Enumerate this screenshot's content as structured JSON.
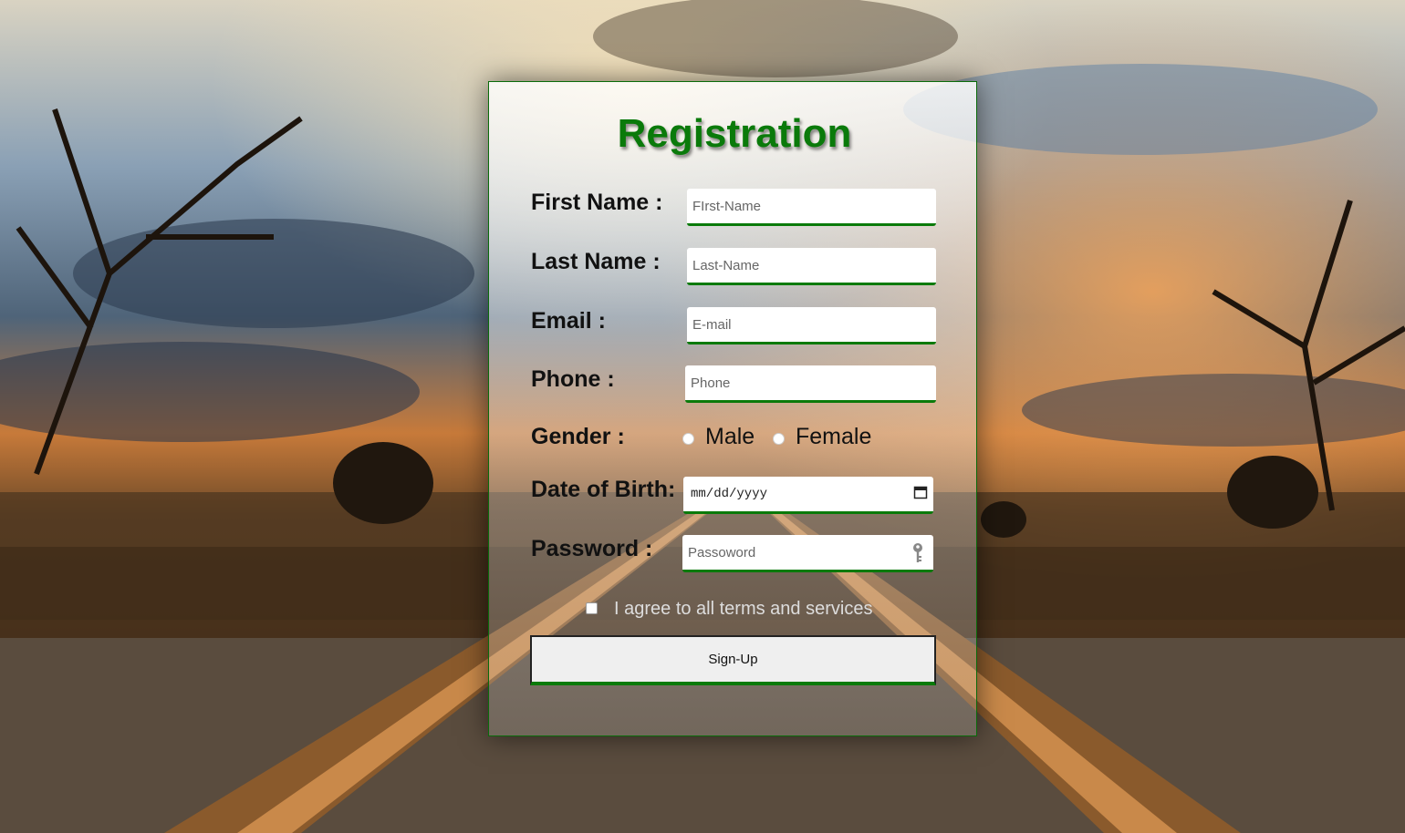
{
  "form": {
    "title": "Registration",
    "accent_color": "#0a7a0a",
    "first_name": {
      "label": "First Name :",
      "placeholder": "FIrst-Name"
    },
    "last_name": {
      "label": "Last Name :",
      "placeholder": "Last-Name"
    },
    "email": {
      "label": "Email :",
      "placeholder": "E-mail"
    },
    "phone": {
      "label": "Phone :",
      "placeholder": "Phone"
    },
    "gender": {
      "label": "Gender :",
      "options": [
        "Male",
        "Female"
      ]
    },
    "dob": {
      "label": "Date of Birth:",
      "placeholder": "mm/dd/yyyy"
    },
    "password": {
      "label": "Password :",
      "placeholder": "Passoword"
    },
    "terms": {
      "label": "I agree to all terms and services",
      "checked": false
    },
    "submit_label": "Sign-Up"
  },
  "background": {
    "icon": "railroad-sunset-image"
  }
}
